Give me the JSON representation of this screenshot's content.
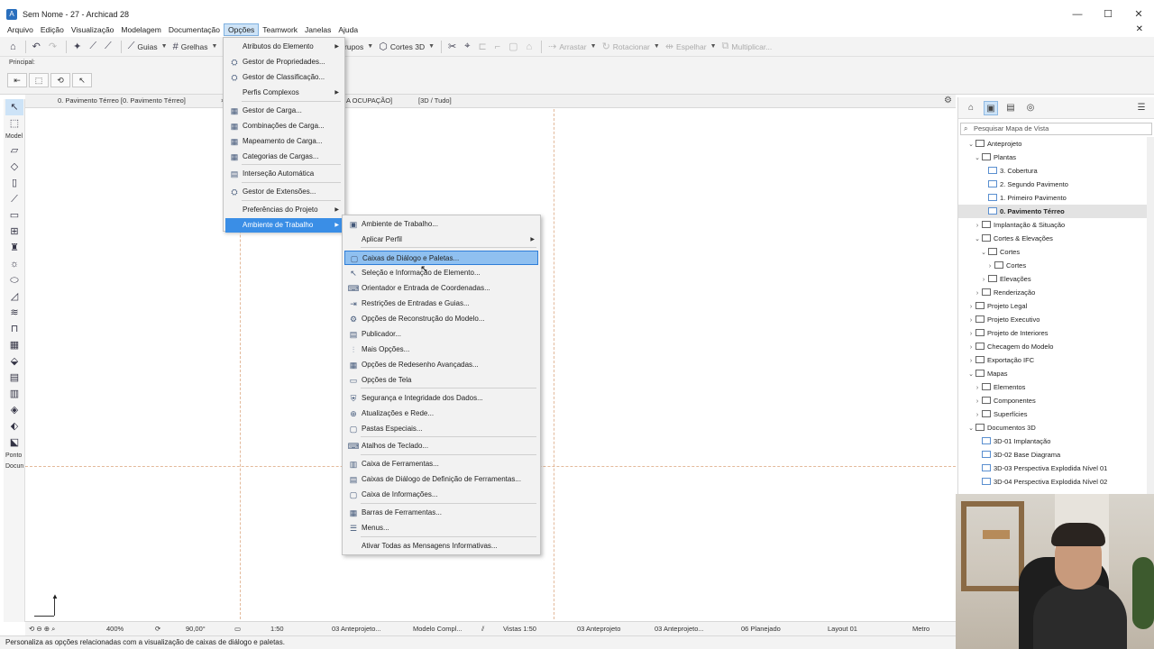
{
  "window": {
    "title": "Sem Nome - 27 - Archicad 28",
    "controls": [
      "—",
      "☐",
      "✕"
    ]
  },
  "menubar": {
    "items": [
      "Arquivo",
      "Edição",
      "Visualização",
      "Modelagem",
      "Documentação",
      "Opções",
      "Teamwork",
      "Janelas",
      "Ajuda"
    ],
    "close": "✕"
  },
  "toolbar": {
    "guias": "Guias",
    "grelhas": "Grelhas",
    "grupos": "Grupos",
    "cortes3d": "Cortes 3D",
    "arrastar": "Arrastar",
    "rotacionar": "Rotacionar",
    "espelhar": "Espelhar",
    "multiplicar": "Multiplicar..."
  },
  "infobar": {
    "label": "Principal:"
  },
  "tabs": {
    "plan": "0. Pavimento Térreo [0. Pavimento Térreo]",
    "close": "×",
    "partial": "A OCUPAÇÃO]",
    "view3d": "[3D / Tudo]"
  },
  "toolbox": {
    "model": "Model",
    "ponto": "Ponto",
    "docum": "Docun"
  },
  "options_menu": {
    "items": [
      {
        "label": "Atributos do Elemento",
        "sub": true
      },
      {
        "label": "Gestor de Propriedades..."
      },
      {
        "label": "Gestor de Classificação..."
      },
      {
        "label": "Perfis Complexos",
        "sub": true
      },
      {
        "label": "Gestor de Carga..."
      },
      {
        "label": "Combinações de Carga..."
      },
      {
        "label": "Mapeamento de Carga..."
      },
      {
        "label": "Categorias de Cargas..."
      },
      {
        "label": "Interseção Automática"
      },
      {
        "label": "Gestor de Extensões..."
      },
      {
        "label": "Preferências do Projeto",
        "sub": true
      },
      {
        "label": "Ambiente de Trabalho",
        "sub": true
      }
    ]
  },
  "work_env_menu": {
    "items": [
      {
        "label": "Ambiente de Trabalho..."
      },
      {
        "label": "Aplicar Perfil",
        "sub": true
      },
      {
        "label": "Caixas de Diálogo e Paletas..."
      },
      {
        "label": "Seleção e Informação de Elemento..."
      },
      {
        "label": "Orientador e Entrada de Coordenadas..."
      },
      {
        "label": "Restrições de Entradas e Guias..."
      },
      {
        "label": "Opções de Reconstrução do Modelo..."
      },
      {
        "label": "Publicador..."
      },
      {
        "label": "Mais Opções..."
      },
      {
        "label": "Opções de Redesenho Avançadas..."
      },
      {
        "label": "Opções de Tela"
      },
      {
        "label": "Segurança e Integridade dos Dados..."
      },
      {
        "label": "Atualizações e Rede..."
      },
      {
        "label": "Pastas Especiais..."
      },
      {
        "label": "Atalhos de Teclado..."
      },
      {
        "label": "Caixa de Ferramentas..."
      },
      {
        "label": "Caixas de Diálogo de Definição de Ferramentas..."
      },
      {
        "label": "Caixa de Informações..."
      },
      {
        "label": "Barras de Ferramentas..."
      },
      {
        "label": "Menus..."
      },
      {
        "label": "Ativar Todas as Mensagens Informativas..."
      }
    ]
  },
  "navigator": {
    "search_placeholder": "Pesquisar Mapa de Vista",
    "tree": [
      {
        "label": "Anteprojeto",
        "level": 0,
        "open": true
      },
      {
        "label": "Plantas",
        "level": 1,
        "open": true
      },
      {
        "label": "3. Cobertura",
        "level": 2,
        "view": true
      },
      {
        "label": "2. Segundo Pavimento",
        "level": 2,
        "view": true
      },
      {
        "label": "1. Primeiro Pavimento",
        "level": 2,
        "view": true
      },
      {
        "label": "0. Pavimento Térreo",
        "level": 2,
        "view": true,
        "selected": true
      },
      {
        "label": "Implantação & Situação",
        "level": 1,
        "closed": true
      },
      {
        "label": "Cortes & Elevações",
        "level": 1,
        "open": true
      },
      {
        "label": "Cortes",
        "level": 2,
        "open": true
      },
      {
        "label": "Cortes",
        "level": 3,
        "closed": true
      },
      {
        "label": "Elevações",
        "level": 2,
        "closed": true
      },
      {
        "label": "Renderização",
        "level": 1,
        "closed": true
      },
      {
        "label": "Projeto Legal",
        "level": 0,
        "closed": true
      },
      {
        "label": "Projeto Executivo",
        "level": 0,
        "closed": true
      },
      {
        "label": "Projeto de Interiores",
        "level": 0,
        "closed": true
      },
      {
        "label": "Checagem do Modelo",
        "level": 0,
        "closed": true
      },
      {
        "label": "Exportação IFC",
        "level": 0,
        "closed": true
      },
      {
        "label": "Mapas",
        "level": 0,
        "open": true
      },
      {
        "label": "Elementos",
        "level": 1,
        "closed": true
      },
      {
        "label": "Componentes",
        "level": 1,
        "closed": true
      },
      {
        "label": "Superfícies",
        "level": 1,
        "closed": true
      },
      {
        "label": "Documentos 3D",
        "level": 0,
        "open": true
      },
      {
        "label": "3D-01 Implantação",
        "level": 1,
        "view": true
      },
      {
        "label": "3D-02 Base Diagrama",
        "level": 1,
        "view": true
      },
      {
        "label": "3D-03 Perspectiva Explodida Nível 01",
        "level": 1,
        "view": true
      },
      {
        "label": "3D-04 Perspectiva Explodida Nível 02",
        "level": 1,
        "view": true
      }
    ]
  },
  "bottombar": {
    "zoom": "400%",
    "angle": "90,00°",
    "scale": "1:50",
    "layer": "03 Anteprojeto...",
    "model": "Modelo Compl...",
    "views": "Vistas 1:50",
    "pen1": "03 Anteprojeto",
    "pen2": "03 Anteprojeto...",
    "reno": "06 Planejado",
    "layout": "Layout 01",
    "unit": "Metro"
  },
  "status": "Personaliza as opções relacionadas com a visualização de caixas de diálogo e paletas."
}
